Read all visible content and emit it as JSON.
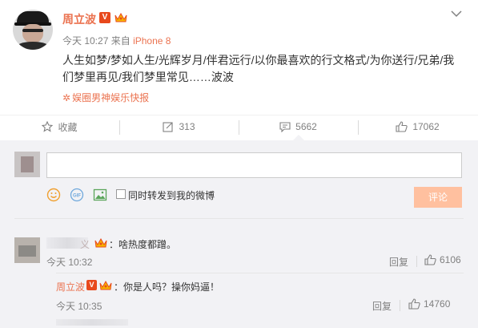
{
  "post": {
    "username": "周立波",
    "verified_badge": "V",
    "time": "今天 10:27",
    "from_label": "来自",
    "device": "iPhone 8",
    "text": "人生如梦/梦如人生/光辉岁月/伴君远行/以你最喜欢的行文格式/为你送行/兄弟/我们梦里再见/我们梦里常见……波波",
    "source_icon": "sparkle-icon",
    "source": "娱圈男神娱乐快报"
  },
  "actions": {
    "favorite_label": "收藏",
    "repost_count": "313",
    "comment_count": "5662",
    "like_count": "17062"
  },
  "compose": {
    "input_value": "",
    "forward_label": "同时转发到我的微博",
    "submit_label": "评论"
  },
  "comments": [
    {
      "name_tail": "义",
      "text": "：啥热度都蹭。",
      "time": "今天 10:32",
      "reply_label": "回复",
      "likes": "6106",
      "replies": [
        {
          "name": "周立波",
          "verified_badge": "V",
          "text": "：你是人吗？操你妈逼！",
          "time": "今天 10:35",
          "reply_label": "回复",
          "likes": "14760"
        }
      ]
    }
  ],
  "colors": {
    "accent": "#eb7350",
    "verified": "#e8491d",
    "muted": "#808080",
    "panel": "#f2f2f5",
    "submit_disabled": "#ffc09f"
  }
}
